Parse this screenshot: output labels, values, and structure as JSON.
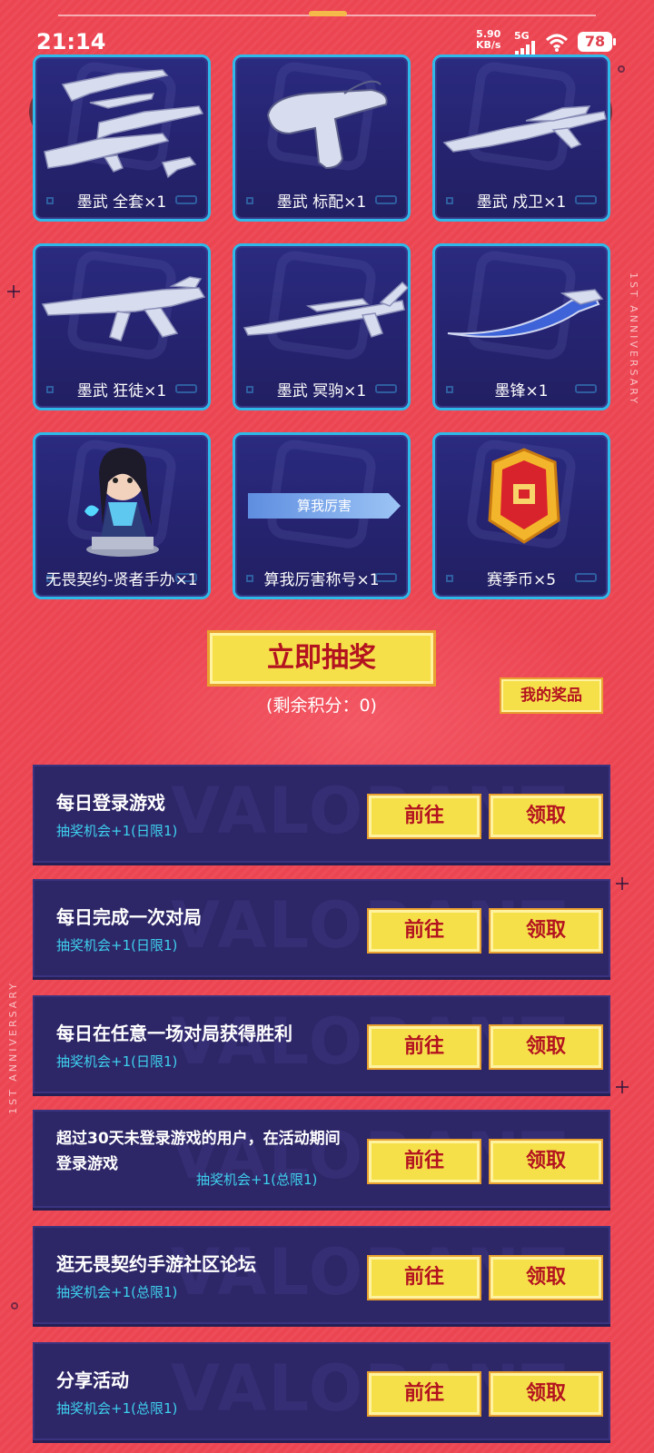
{
  "status": {
    "time": "21:14",
    "speed_value": "5.90",
    "speed_unit": "KB/s",
    "network": "5G",
    "battery": "78"
  },
  "nav": {
    "back_icon": "chevron-left-icon",
    "share_icon": "share-icon"
  },
  "side_text": "1ST ANNIVERSARY",
  "prizes": [
    {
      "label": "墨武 全套×1",
      "icon": "weapon-set-icon"
    },
    {
      "label": "墨武 标配×1",
      "icon": "pistol-icon"
    },
    {
      "label": "墨武 戍卫×1",
      "icon": "rifle-icon"
    },
    {
      "label": "墨武 狂徒×1",
      "icon": "assault-rifle-icon"
    },
    {
      "label": "墨武 冥驹×1",
      "icon": "sniper-rifle-icon"
    },
    {
      "label": "墨锋×1",
      "icon": "blade-icon"
    },
    {
      "label": "无畏契约-贤者手办×1",
      "icon": "figure-icon"
    },
    {
      "label": "算我厉害称号×1",
      "icon": "title-badge-icon",
      "badge_text": "算我厉害"
    },
    {
      "label": "赛季币×5",
      "icon": "season-coin-icon"
    }
  ],
  "draw": {
    "button_label": "立即抽奖",
    "remaining": "(剩余积分：0)",
    "my_prizes": "我的奖品"
  },
  "tasks_bg_word": "VALORANT",
  "tasks": [
    {
      "title": "每日登录游戏",
      "sub": "抽奖机会+1(日限1)",
      "go": "前往",
      "claim": "领取"
    },
    {
      "title": "每日完成一次对局",
      "sub": "抽奖机会+1(日限1)",
      "go": "前往",
      "claim": "领取"
    },
    {
      "title": "每日在任意一场对局获得胜利",
      "sub": "抽奖机会+1(日限1)",
      "go": "前往",
      "claim": "领取"
    },
    {
      "title": "超过30天未登录游戏的用户，在活动期间登录游戏",
      "sub": "抽奖机会+1(总限1)",
      "go": "前往",
      "claim": "领取"
    },
    {
      "title": "逛无畏契约手游社区论坛",
      "sub": "抽奖机会+1(总限1)",
      "go": "前往",
      "claim": "领取"
    },
    {
      "title": "分享活动",
      "sub": "抽奖机会+1(总限1)",
      "go": "前往",
      "claim": "领取"
    }
  ]
}
